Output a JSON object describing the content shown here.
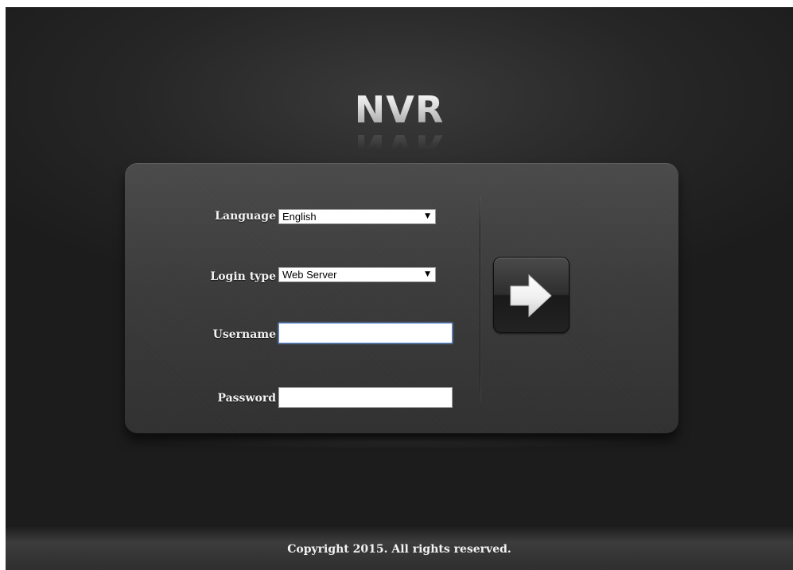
{
  "brand": {
    "title": "NVR"
  },
  "login_form": {
    "language": {
      "label": "Language",
      "selected": "English"
    },
    "login_type": {
      "label": "Login type",
      "selected": "Web Server"
    },
    "username": {
      "label": "Username",
      "value": "",
      "placeholder": ""
    },
    "password": {
      "label": "Password",
      "value": "",
      "placeholder": ""
    },
    "submit": {
      "icon": "arrow-right-icon"
    }
  },
  "footer": {
    "copyright": "Copyright 2015. All rights reserved."
  },
  "colors": {
    "background": "#1c1c1c",
    "panel": "#3b3b3b",
    "focus_border": "#5b8fd6",
    "text": "#f4f4f4"
  }
}
